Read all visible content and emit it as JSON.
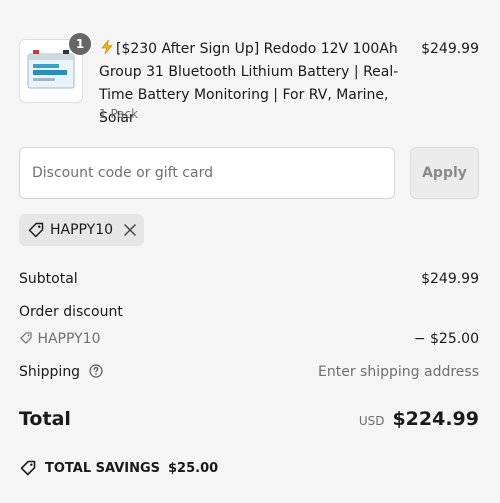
{
  "product": {
    "quantity_badge": "1",
    "title": "[$230 After Sign Up] Redodo 12V 100Ah Group 31 Bluetooth Lithium Battery | Real-Time Battery Monitoring | For RV, Marine, Solar",
    "variant": "1 Pack",
    "price": "$249.99",
    "title_icon": "lightning-bolt-icon"
  },
  "discount": {
    "placeholder": "Discount code or gift card",
    "apply_label": "Apply",
    "applied_code": "HAPPY10"
  },
  "summary": {
    "subtotal_label": "Subtotal",
    "subtotal_value": "$249.99",
    "order_discount_label": "Order discount",
    "discount_code": "HAPPY10",
    "discount_value": "− $25.00",
    "shipping_label": "Shipping",
    "shipping_value": "Enter shipping address",
    "total_label": "Total",
    "currency": "USD",
    "total_value": "$224.99",
    "savings_label": "TOTAL SAVINGS",
    "savings_value": "$25.00"
  },
  "colors": {
    "background": "#f5f5f5",
    "badge": "#666666",
    "muted_text": "#707070",
    "bolt": "#f5b400"
  }
}
